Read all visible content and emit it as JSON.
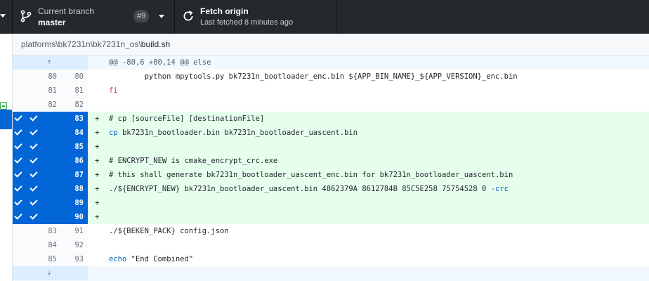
{
  "toolbar": {
    "branch": {
      "label": "Current branch",
      "value": "master",
      "badge": "#9"
    },
    "fetch": {
      "label": "Fetch origin",
      "value": "Last fetched 8 minutes ago"
    }
  },
  "breadcrumb": {
    "path": "platforms\\bk7231n\\bk7231n_os\\",
    "file": "build.sh"
  },
  "hunk": {
    "header": "@@ -80,6 +80,14 @@ else"
  },
  "lines": [
    {
      "old": "80",
      "new": "80",
      "sym": "",
      "text": "        python mpytools.py bk7231n_bootloader_enc.bin ${APP_BIN_NAME}_${APP_VERSION}_enc.bin"
    },
    {
      "old": "81",
      "new": "81",
      "sym": "",
      "text": "fi"
    },
    {
      "old": "82",
      "new": "82",
      "sym": "",
      "text": ""
    },
    {
      "old": "",
      "new": "83",
      "sym": "+",
      "text": "# cp [sourceFile] [destinationFile]"
    },
    {
      "old": "",
      "new": "84",
      "sym": "+",
      "text": "cp bk7231n_bootloader.bin bk7231n_bootloader_uascent.bin"
    },
    {
      "old": "",
      "new": "85",
      "sym": "+",
      "text": ""
    },
    {
      "old": "",
      "new": "86",
      "sym": "+",
      "text": "# ENCRYPT_NEW is cmake_encrypt_crc.exe"
    },
    {
      "old": "",
      "new": "87",
      "sym": "+",
      "text": "# this shall generate bk7231n_bootloader_uascent_enc.bin for bk7231n_bootloader_uascent.bin"
    },
    {
      "old": "",
      "new": "88",
      "sym": "+",
      "text": "./${ENCRYPT_NEW} bk7231n_bootloader_uascent.bin 4862379A 8612784B 85C5E258 75754528 0 -crc"
    },
    {
      "old": "",
      "new": "89",
      "sym": "+",
      "text": ""
    },
    {
      "old": "",
      "new": "90",
      "sym": "+",
      "text": ""
    },
    {
      "old": "83",
      "new": "91",
      "sym": "",
      "text": "./${BEKEN_PACK} config.json"
    },
    {
      "old": "84",
      "new": "92",
      "sym": "",
      "text": ""
    },
    {
      "old": "85",
      "new": "93",
      "sym": "",
      "text": "echo \"End Combined\""
    }
  ],
  "icons": [
    "branch-icon",
    "sync-icon",
    "expand-up-icon",
    "expand-down-icon",
    "check-icon"
  ],
  "colors": {
    "toolbar": "#24292e",
    "selected": "#0366d6",
    "added": "#e6ffed",
    "hunk": "#f1f8ff"
  }
}
